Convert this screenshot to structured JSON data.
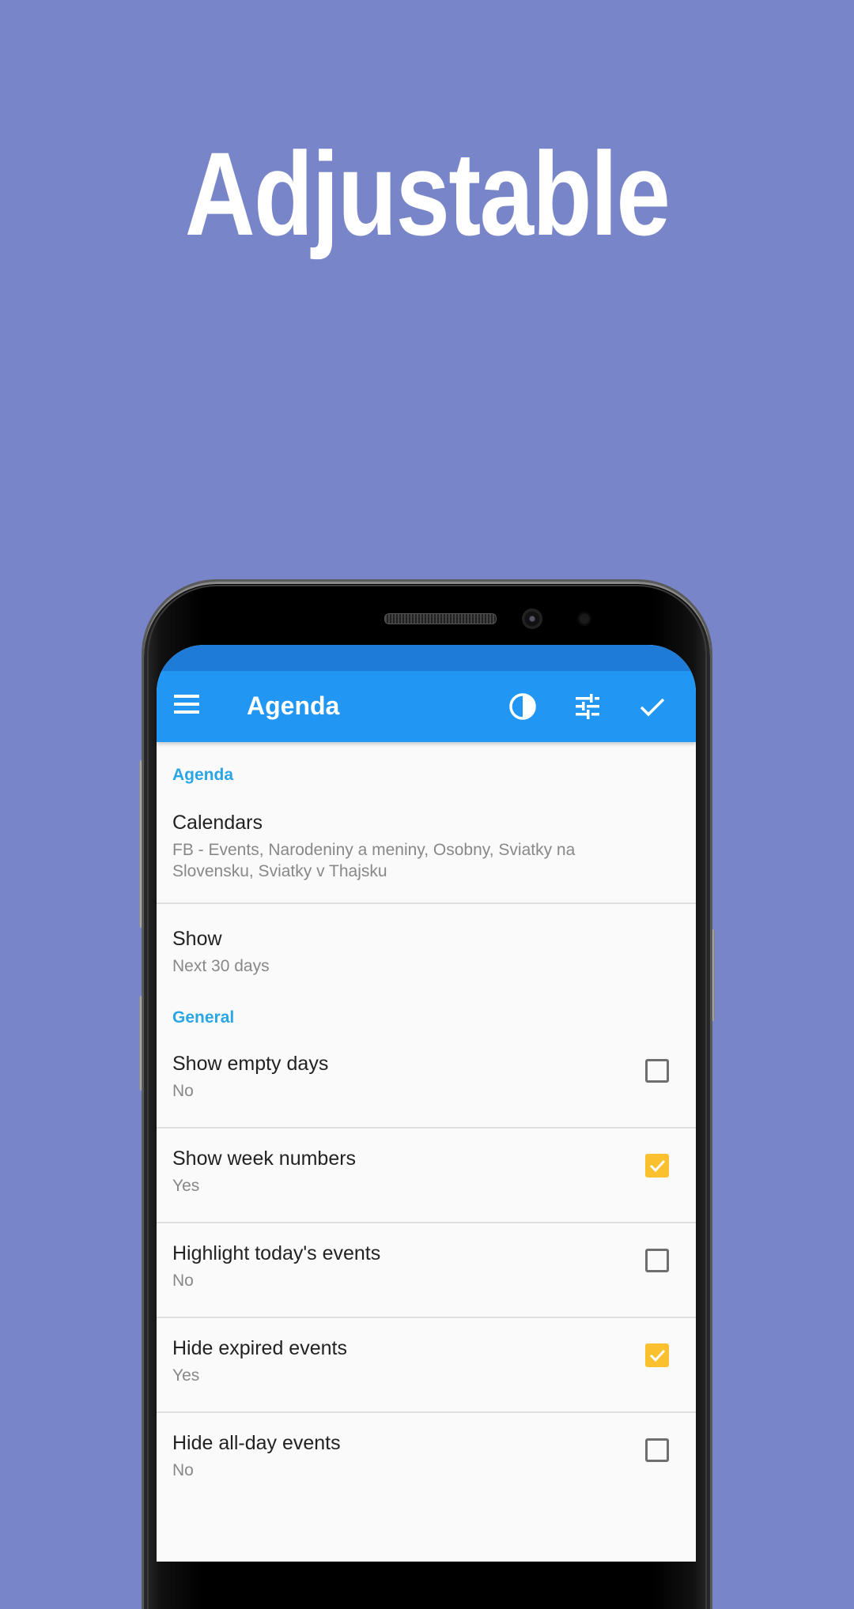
{
  "headline": "Adjustable",
  "app_bar": {
    "title": "Agenda",
    "icons": [
      "menu-icon",
      "theme-contrast-icon",
      "tune-icon",
      "check-icon"
    ]
  },
  "sections": [
    {
      "header": "Agenda",
      "items": [
        {
          "title": "Calendars",
          "summary": "FB - Events, Narodeniny a meniny, Osobny, Sviatky na Slovensku, Sviatky v Thajsku"
        },
        {
          "title": "Show",
          "summary": "Next 30 days"
        }
      ]
    },
    {
      "header": "General",
      "items": [
        {
          "title": "Show empty days",
          "summary": "No",
          "checked": false
        },
        {
          "title": "Show week numbers",
          "summary": "Yes",
          "checked": true
        },
        {
          "title": "Highlight today's events",
          "summary": "No",
          "checked": false
        },
        {
          "title": "Hide expired events",
          "summary": "Yes",
          "checked": true
        },
        {
          "title": "Hide all-day events",
          "summary": "No",
          "checked": false
        }
      ]
    }
  ],
  "colors": {
    "background": "#7886c9",
    "app_bar": "#2196f3",
    "status_bar": "#1e7bd7",
    "section_header": "#29a6e3",
    "checkbox_checked": "#fbc02d"
  }
}
